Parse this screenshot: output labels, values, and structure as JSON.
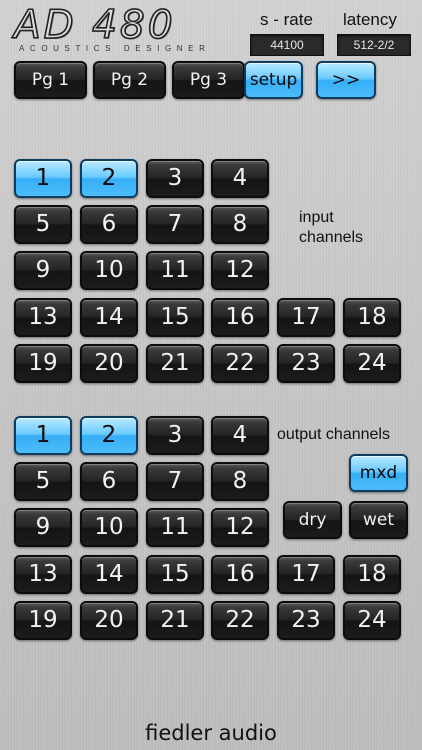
{
  "logo": {
    "main": "AD 480",
    "sub": "ACOUSTICS DESIGNER"
  },
  "status": {
    "srate_label": "s - rate",
    "srate_value": "44100",
    "latency_label": "latency",
    "latency_value": "512-2/2"
  },
  "nav": {
    "pg1": "Pg 1",
    "pg2": "Pg 2",
    "pg3": "Pg 3",
    "setup": "setup",
    "next": ">>"
  },
  "input_section": {
    "label": "input channels",
    "selected": [
      1,
      2
    ]
  },
  "output_section": {
    "label": "output channels",
    "selected": [
      1,
      2
    ]
  },
  "mix": {
    "mxd": "mxd",
    "dry": "dry",
    "wet": "wet"
  },
  "channels": [
    "1",
    "2",
    "3",
    "4",
    "5",
    "6",
    "7",
    "8",
    "9",
    "10",
    "11",
    "12",
    "13",
    "14",
    "15",
    "16",
    "17",
    "18",
    "19",
    "20",
    "21",
    "22",
    "23",
    "24"
  ],
  "footer": "fiedler audio",
  "colors": {
    "selected": "#4cbcfb",
    "button_dark": "#1c1c1c",
    "background": "#c6c6c6"
  }
}
